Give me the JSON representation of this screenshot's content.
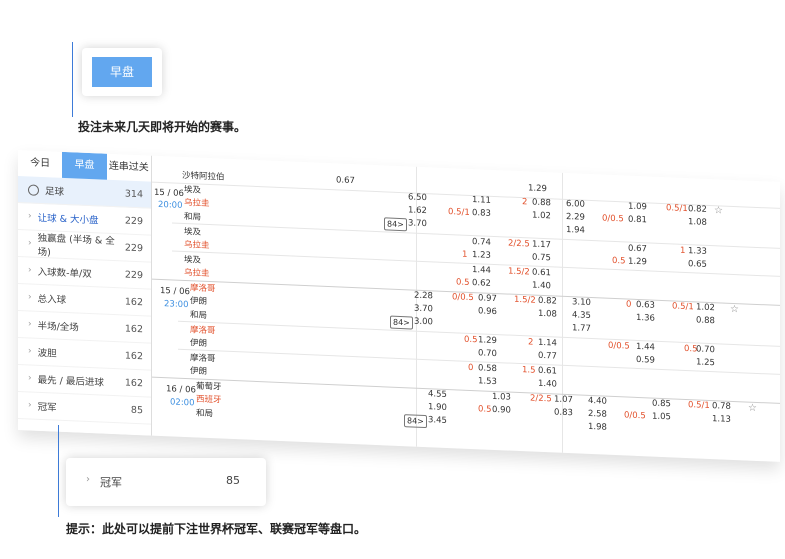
{
  "callout_tab": {
    "label": "早盘"
  },
  "intro_text": "投注未来几天即将开始的赛事。",
  "tip_text": "提示：此处可以提前下注世界杯冠军、联赛冠军等盘口。",
  "side_tabs": [
    "今日",
    "早盘",
    "连串过关"
  ],
  "sport": {
    "label": "足球",
    "count": "314"
  },
  "menu": [
    {
      "label": "让球 & 大小盘",
      "count": "229"
    },
    {
      "label": "独赢盘 (半场 & 全场)",
      "count": "229"
    },
    {
      "label": "入球数-单/双",
      "count": "229"
    },
    {
      "label": "总入球",
      "count": "162"
    },
    {
      "label": "半场/全场",
      "count": "162"
    },
    {
      "label": "波胆",
      "count": "162"
    },
    {
      "label": "最先 / 最后进球",
      "count": "162"
    },
    {
      "label": "冠军",
      "count": "85"
    }
  ],
  "zoom_item": {
    "label": "冠军",
    "count": "85"
  },
  "odds": {
    "top_team": "沙特阿拉伯",
    "top_vals": [
      "0.67",
      "1.29"
    ],
    "m1": {
      "date": "15 / 06",
      "time": "20:00",
      "home": "埃及",
      "away": "乌拉圭",
      "draw": "和局",
      "more": "84>",
      "row1": [
        "6.50",
        "1.11",
        "2",
        "0.88",
        "6.00",
        "1.09",
        "0.5/1",
        "0.82"
      ],
      "row2": [
        "1.62",
        "0.5/1",
        "0.83",
        "1.02",
        "2.29",
        "0/0.5",
        "0.81",
        "1.08"
      ],
      "row3": [
        "3.70",
        "1.94"
      ],
      "s1": [
        "埃及",
        "0.74",
        "2/2.5",
        "1.17",
        "0.67",
        "1",
        "1.33"
      ],
      "s2": [
        "乌拉圭",
        "1",
        "1.23",
        "0.75",
        "0.5",
        "1.29",
        "0.65"
      ],
      "s3": [
        "埃及",
        "1.44",
        "1.5/2",
        "0.61"
      ],
      "s4": [
        "乌拉圭",
        "0.5",
        "0.62",
        "1.40"
      ]
    },
    "m2": {
      "date": "15 / 06",
      "time": "23:00",
      "home": "摩洛哥",
      "away": "伊朗",
      "draw": "和局",
      "more": "84>",
      "row1": [
        "2.28",
        "0/0.5",
        "0.97",
        "1.5/2",
        "0.82",
        "3.10",
        "0",
        "0.63",
        "0.5/1",
        "1.02"
      ],
      "row2": [
        "3.70",
        "0.96",
        "1.08",
        "4.35",
        "1.36",
        "0.88"
      ],
      "row3": [
        "3.00",
        "1.77"
      ],
      "s1": [
        "摩洛哥",
        "0.5",
        "1.29",
        "2",
        "1.14",
        "0/0.5",
        "1.44",
        "0.5",
        "0.70"
      ],
      "s2": [
        "伊朗",
        "0.70",
        "0.77",
        "0.59",
        "1.25"
      ],
      "s3": [
        "摩洛哥",
        "0",
        "0.58",
        "1.5",
        "0.61"
      ],
      "s4": [
        "伊朗",
        "1.53",
        "1.40"
      ]
    },
    "m3": {
      "date": "16 / 06",
      "time": "02:00",
      "home": "葡萄牙",
      "away": "西班牙",
      "draw": "和局",
      "more": "84>",
      "row1": [
        "4.55",
        "1.03",
        "2/2.5",
        "1.07",
        "4.40",
        "0.85",
        "0.5/1",
        "0.78"
      ],
      "row2": [
        "1.90",
        "0.5",
        "0.90",
        "0.83",
        "2.58",
        "0/0.5",
        "1.05",
        "1.13"
      ],
      "row3": [
        "3.45",
        "1.98"
      ]
    }
  }
}
